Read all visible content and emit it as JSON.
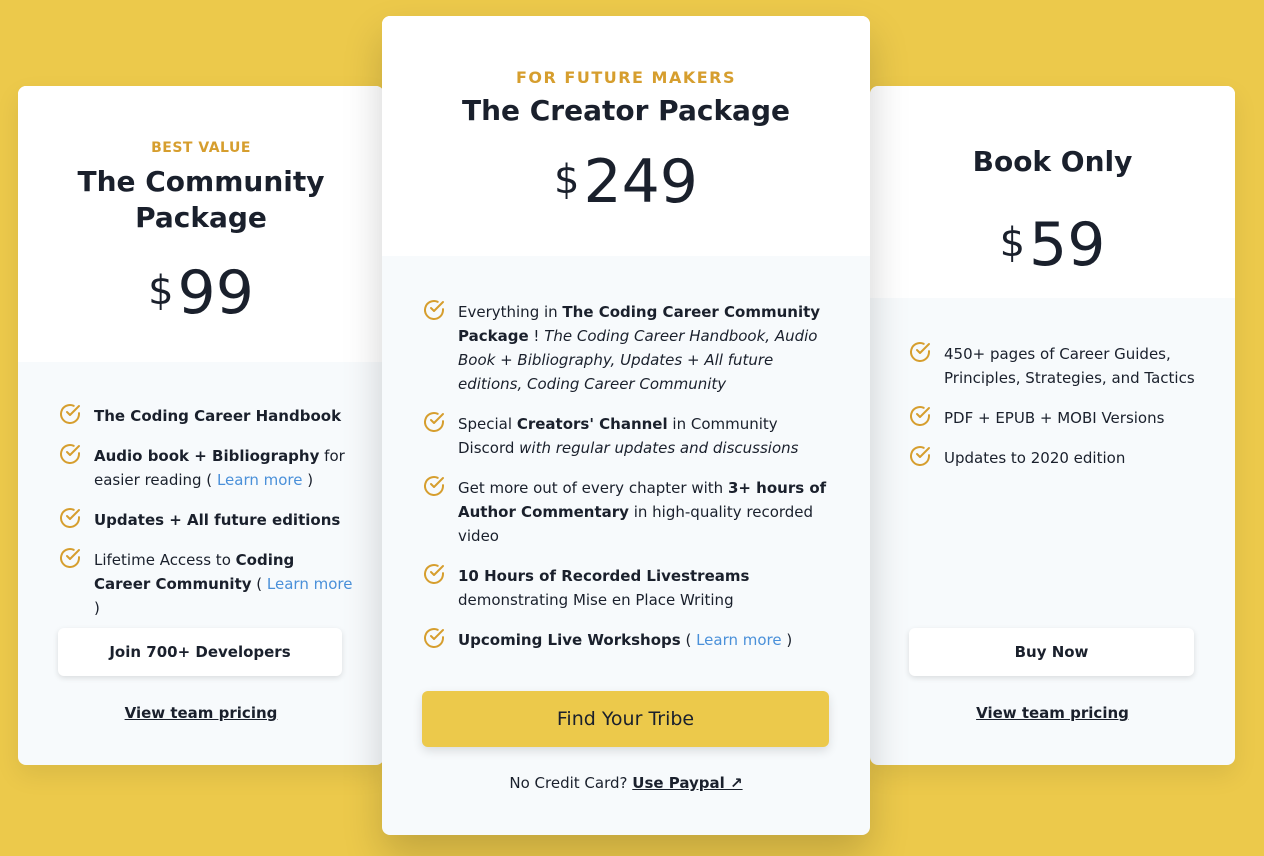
{
  "colors": {
    "background": "#ecc94b",
    "accent": "#d69e2e",
    "link": "#4a90d9",
    "check": "#d69e2e"
  },
  "community": {
    "eyebrow": "BEST VALUE",
    "title": "The Community Package",
    "currency": "$",
    "price": "99",
    "features": [
      {
        "bold": "The Coding Career Handbook",
        "text": ""
      },
      {
        "bold": "Audio book + Bibliography",
        "text": " for easier reading ( ",
        "link": "Learn more",
        "after": " )"
      },
      {
        "bold": "Updates + All future editions",
        "text": ""
      },
      {
        "pre": "Lifetime Access to ",
        "bold": "Coding Career Community",
        "text": " ( ",
        "link": "Learn more",
        "after": " )"
      }
    ],
    "button": "Join 700+ Developers",
    "team_link": "View team pricing"
  },
  "creator": {
    "eyebrow": "FOR FUTURE MAKERS",
    "title": "The Creator Package",
    "currency": "$",
    "price": "249",
    "features": [
      {
        "pre": "Everything in ",
        "bold": "The Coding Career Community Package",
        "text": " ! ",
        "italic": "The Coding Career Handbook, Audio Book + Bibliography, Updates + All future editions, Coding Career Community"
      },
      {
        "pre": "Special ",
        "bold": "Creators' Channel",
        "text": " in Community Discord ",
        "italic": "with regular updates and discussions"
      },
      {
        "pre": "Get more out of every chapter with ",
        "bold": "3+ hours of Author Commentary",
        "text": " in high-quality recorded video"
      },
      {
        "bold": "10 Hours of Recorded Livestreams",
        "text": " demonstrating Mise en Place Writing"
      },
      {
        "bold": "Upcoming Live Workshops",
        "text": " ( ",
        "link": "Learn more",
        "after": " )"
      }
    ],
    "button": "Find Your Tribe",
    "paypal_prefix": "No Credit Card? ",
    "paypal_link": "Use Paypal ↗"
  },
  "book": {
    "title": "Book Only",
    "currency": "$",
    "price": "59",
    "features": [
      "450+ pages of Career Guides, Principles, Strategies, and Tactics",
      "PDF + EPUB + MOBI Versions",
      "Updates to 2020 edition"
    ],
    "button": "Buy Now",
    "team_link": "View team pricing"
  }
}
